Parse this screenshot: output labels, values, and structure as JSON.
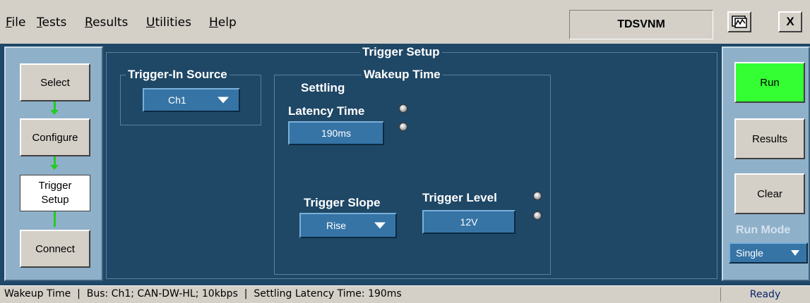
{
  "menubar": {
    "items": [
      {
        "label": "File"
      },
      {
        "label": "Tests"
      },
      {
        "label": "Results"
      },
      {
        "label": "Utilities"
      },
      {
        "label": "Help"
      }
    ],
    "app_title": "TDSVNM",
    "restore_icon": "waveform-window-icon",
    "close_label": "X"
  },
  "nav": {
    "select": "Select",
    "configure": "Configure",
    "trigger_setup_line1": "Trigger",
    "trigger_setup_line2": "Setup",
    "connect": "Connect",
    "arrow_color": "#22cc22"
  },
  "main": {
    "title": "Trigger Setup",
    "trigger_in_source": {
      "legend": "Trigger-In Source",
      "value": "Ch1"
    },
    "wakeup_time": {
      "legend": "Wakeup Time",
      "settling_label": "Settling",
      "latency_label": "Latency Time",
      "latency_value": "190ms",
      "trigger_slope_label": "Trigger Slope",
      "trigger_slope_value": "Rise",
      "trigger_level_label": "Trigger Level",
      "trigger_level_value": "12V"
    }
  },
  "side": {
    "run": "Run",
    "run_color": "#33ff33",
    "results": "Results",
    "clear": "Clear",
    "run_mode_label": "Run Mode",
    "run_mode_value": "Single"
  },
  "status": {
    "text": "Wakeup Time  |  Bus: Ch1; CAN-DW-HL; 10kbps  |  Settling Latency Time: 190ms",
    "ready": "Ready"
  }
}
